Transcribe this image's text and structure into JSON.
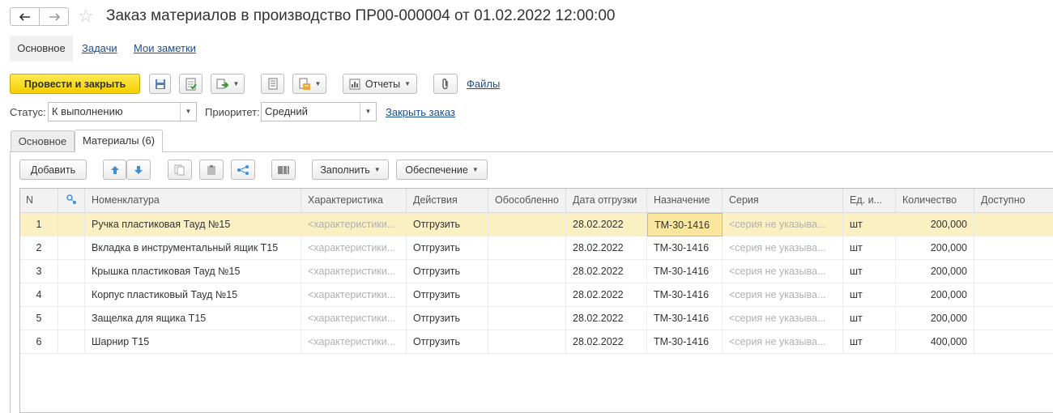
{
  "window": {
    "title": "Заказ материалов в производство ПР00-000004 от 01.02.2022 12:00:00"
  },
  "top_tabs": {
    "main": "Основное",
    "tasks": "Задачи",
    "notes": "Мои заметки"
  },
  "toolbar": {
    "post_close": "Провести и закрыть",
    "reports": "Отчеты",
    "files": "Файлы"
  },
  "status_row": {
    "status_label": "Статус:",
    "status_value": "К выполнению",
    "priority_label": "Приоритет:",
    "priority_value": "Средний",
    "close_order": "Закрыть заказ"
  },
  "form_tabs": {
    "main": "Основное",
    "materials": "Материалы (6)"
  },
  "grid_toolbar": {
    "add": "Добавить",
    "fill": "Заполнить",
    "supply": "Обеспечение"
  },
  "table": {
    "columns": [
      "N",
      "",
      "Номенклатура",
      "Характеристика",
      "Действия",
      "Обособленно",
      "Дата отгрузки",
      "Назначение",
      "Серия",
      "Ед. и...",
      "Количество",
      "Доступно"
    ],
    "rows": [
      [
        "1",
        "Ручка пластиковая Тауд №15",
        "<характеристики...",
        "Отгрузить",
        "",
        "28.02.2022",
        "ТМ-30-1416",
        "<серия не указыва...",
        "шт",
        "200,000",
        ""
      ],
      [
        "2",
        "Вкладка в инструментальный ящик Т15",
        "<характеристики...",
        "Отгрузить",
        "",
        "28.02.2022",
        "ТМ-30-1416",
        "<серия не указыва...",
        "шт",
        "200,000",
        ""
      ],
      [
        "3",
        "Крышка пластиковая Тауд №15",
        "<характеристики...",
        "Отгрузить",
        "",
        "28.02.2022",
        "ТМ-30-1416",
        "<серия не указыва...",
        "шт",
        "200,000",
        ""
      ],
      [
        "4",
        "Корпус пластиковый Тауд №15",
        "<характеристики...",
        "Отгрузить",
        "",
        "28.02.2022",
        "ТМ-30-1416",
        "<серия не указыва...",
        "шт",
        "200,000",
        ""
      ],
      [
        "5",
        "Защелка для ящика Т15",
        "<характеристики...",
        "Отгрузить",
        "",
        "28.02.2022",
        "ТМ-30-1416",
        "<серия не указыва...",
        "шт",
        "200,000",
        ""
      ],
      [
        "6",
        "Шарнир Т15",
        "<характеристики...",
        "Отгрузить",
        "",
        "28.02.2022",
        "ТМ-30-1416",
        "<серия не указыва...",
        "шт",
        "400,000",
        ""
      ]
    ]
  },
  "colors": {
    "primary_button": "#f4ce00",
    "selected_row": "#fbf0c2",
    "link": "#1b4e8d"
  }
}
